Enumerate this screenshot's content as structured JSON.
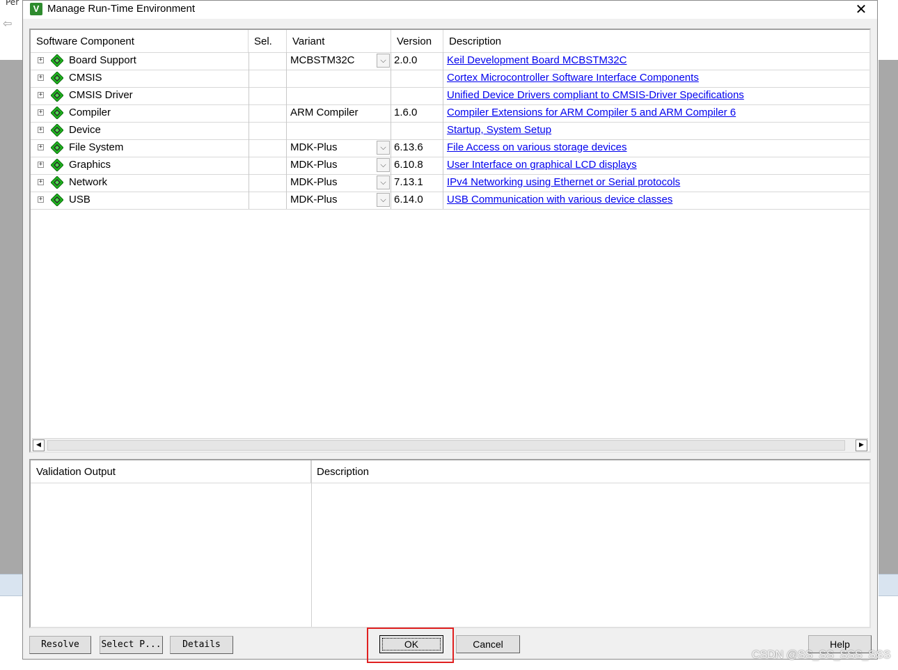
{
  "background": {
    "partial_text": "Per"
  },
  "dialog": {
    "title": "Manage Run-Time Environment",
    "icon": "keil-v-icon",
    "close_glyph": "✕"
  },
  "grid": {
    "headers": {
      "component": "Software Component",
      "sel": "Sel.",
      "variant": "Variant",
      "version": "Version",
      "description": "Description"
    },
    "rows": [
      {
        "name": "Board Support",
        "variant": "MCBSTM32C",
        "has_dropdown": true,
        "version": "2.0.0",
        "description": "Keil Development Board MCBSTM32C"
      },
      {
        "name": "CMSIS",
        "variant": "",
        "has_dropdown": false,
        "version": "",
        "description": "Cortex Microcontroller Software Interface Components"
      },
      {
        "name": "CMSIS Driver",
        "variant": "",
        "has_dropdown": false,
        "version": "",
        "description": "Unified Device Drivers compliant to CMSIS-Driver Specifications"
      },
      {
        "name": "Compiler",
        "variant": "ARM Compiler",
        "has_dropdown": false,
        "version": "1.6.0",
        "description": "Compiler Extensions for ARM Compiler 5 and ARM Compiler 6"
      },
      {
        "name": "Device",
        "variant": "",
        "has_dropdown": false,
        "version": "",
        "description": "Startup, System Setup"
      },
      {
        "name": "File System",
        "variant": "MDK-Plus",
        "has_dropdown": true,
        "version": "6.13.6",
        "description": "File Access on various storage devices"
      },
      {
        "name": "Graphics",
        "variant": "MDK-Plus",
        "has_dropdown": true,
        "version": "6.10.8",
        "description": "User Interface on graphical LCD displays"
      },
      {
        "name": "Network",
        "variant": "MDK-Plus",
        "has_dropdown": true,
        "version": "7.13.1",
        "description": "IPv4 Networking using Ethernet or Serial protocols"
      },
      {
        "name": "USB",
        "variant": "MDK-Plus",
        "has_dropdown": true,
        "version": "6.14.0",
        "description": "USB Communication with various device classes"
      }
    ],
    "expander_glyph": "+",
    "dropdown_glyph": "⌵",
    "scroll_left": "◀",
    "scroll_right": "▶"
  },
  "validation": {
    "headers": {
      "output": "Validation Output",
      "description": "Description"
    }
  },
  "buttons": {
    "resolve": "Resolve",
    "select_packs": "Select P...",
    "details": "Details",
    "ok": "OK",
    "cancel": "Cancel",
    "help": "Help"
  },
  "colors": {
    "link": "#0000ee",
    "highlight_box": "#e02020",
    "component_gem": "#1fb51f"
  },
  "watermark": "CSDN @SS_SS_SSS_SSS"
}
